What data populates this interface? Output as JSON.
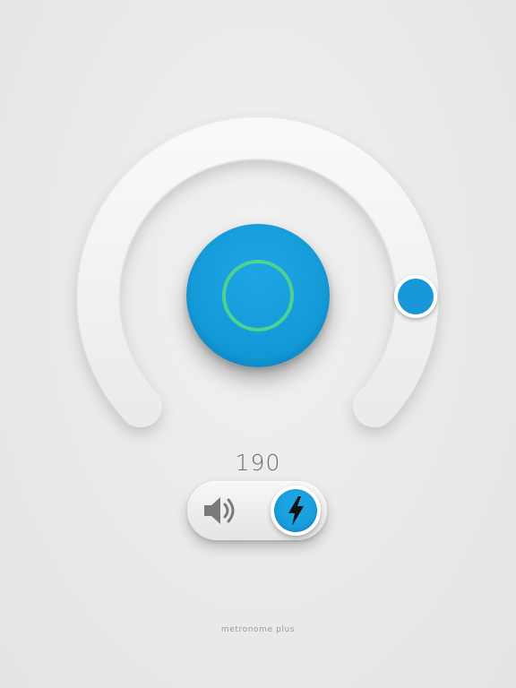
{
  "tempo": {
    "value": "190"
  },
  "start_button": {
    "icon": "ring-icon",
    "ring_color": "#4fd18f"
  },
  "mode_toggle": {
    "options": [
      {
        "icon": "speaker-icon",
        "selected": false
      },
      {
        "icon": "lightning-bolt-icon",
        "selected": true
      }
    ]
  },
  "brand": {
    "label": "metronome plus"
  },
  "colors": {
    "accent": "#149ad8",
    "ring": "#4fd18f",
    "icon_dark": "#2b2b2b",
    "icon_muted": "#7a7a7a",
    "background": "#ececec"
  }
}
